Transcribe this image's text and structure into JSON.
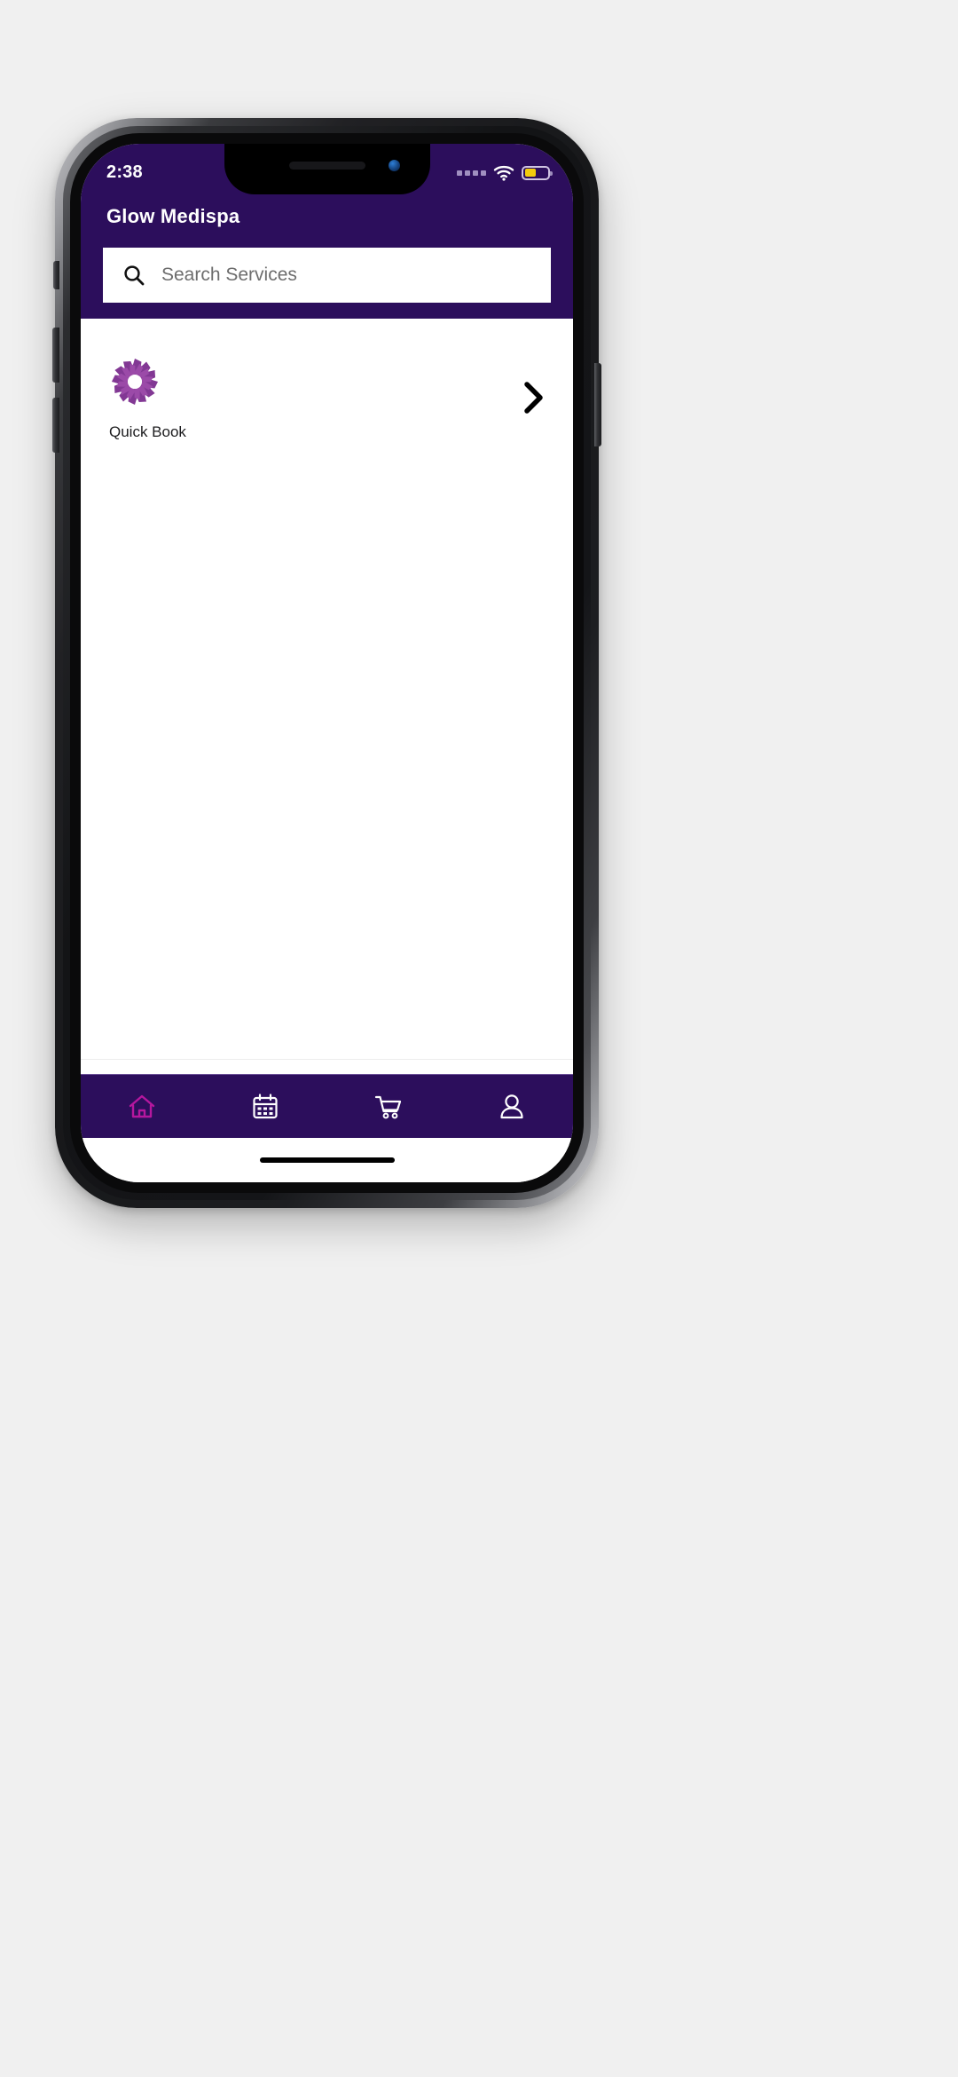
{
  "status_bar": {
    "time": "2:38",
    "signal_dots": 4,
    "wifi_icon": "wifi-icon",
    "battery_icon": "battery-icon",
    "battery_level_percent": 48,
    "battery_color": "#f2cb0c"
  },
  "header": {
    "title": "Glow Medispa",
    "background_color": "#2c0e5c"
  },
  "search": {
    "placeholder": "Search Services",
    "value": "",
    "icon": "search-icon"
  },
  "content": {
    "items": [
      {
        "label": "Quick Book",
        "logo_icon": "mandala-flower-logo",
        "logo_color": "#7b2d8e",
        "chevron_icon": "chevron-right-icon"
      }
    ]
  },
  "bottom_nav": {
    "active_color": "#b5179e",
    "inactive_color": "#ffffff",
    "items": [
      {
        "name": "home",
        "icon": "home-icon",
        "active": true
      },
      {
        "name": "appointments",
        "icon": "calendar-icon",
        "active": false
      },
      {
        "name": "cart",
        "icon": "shopping-cart-icon",
        "active": false
      },
      {
        "name": "profile",
        "icon": "person-icon",
        "active": false
      }
    ]
  },
  "device": {
    "home_indicator": "home-indicator-bar"
  }
}
